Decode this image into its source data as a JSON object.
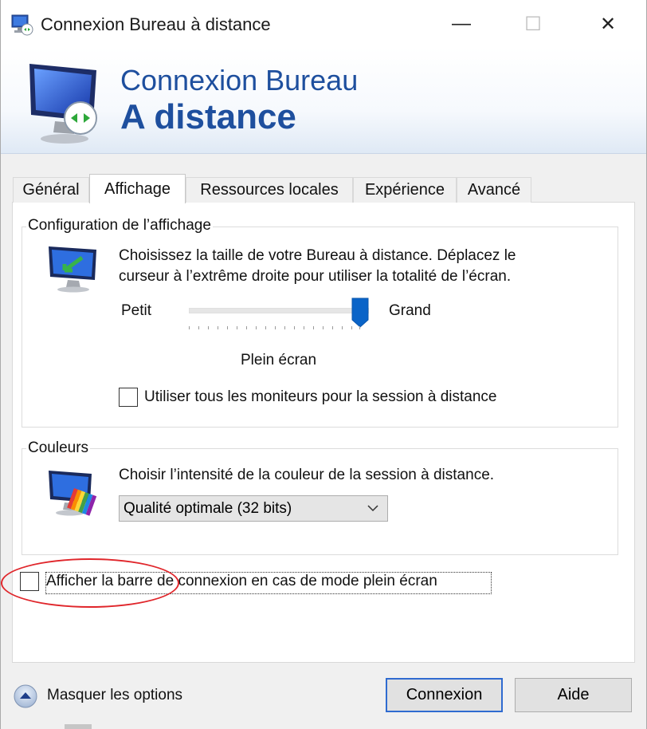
{
  "window": {
    "title": "Connexion Bureau à distance",
    "minimize_glyph": "—",
    "maximize_glyph": "☐",
    "close_glyph": "✕"
  },
  "banner": {
    "line1": "Connexion Bureau",
    "line2": "A distance",
    "icon": "remote-desktop-icon"
  },
  "tabs": [
    {
      "label": "Général",
      "active": false
    },
    {
      "label": "Affichage",
      "active": true
    },
    {
      "label": "Ressources locales",
      "active": false
    },
    {
      "label": "Expérience",
      "active": false
    },
    {
      "label": "Avancé",
      "active": false
    }
  ],
  "display_config": {
    "group_label": "Configuration de l’affichage",
    "description_line1": "Choisissez la taille de votre Bureau à distance. Déplacez le",
    "description_line2": "curseur à l’extrême droite pour utiliser la totalité de l’écran.",
    "slider_min_label": "Petit",
    "slider_max_label": "Grand",
    "slider_value_label": "Plein écran",
    "slider_position": 1.0,
    "all_monitors_label": "Utiliser tous les moniteurs pour la session à distance",
    "all_monitors_checked": false
  },
  "colors": {
    "group_label": "Couleurs",
    "description": "Choisir l’intensité de la couleur de la session à distance.",
    "selected_option": "Qualité optimale (32 bits)"
  },
  "connection_bar": {
    "label": "Afficher la barre de connexion en cas de mode plein écran",
    "checked": false
  },
  "footer": {
    "hide_options_label": "Masquer les options",
    "connect_label": "Connexion",
    "help_label": "Aide"
  },
  "accent": {
    "banner_text": "#1e4f9e",
    "highlight_ellipse": "#e0262b",
    "primary_button_border": "#2f6bd0",
    "slider_thumb": "#0a64c8"
  }
}
